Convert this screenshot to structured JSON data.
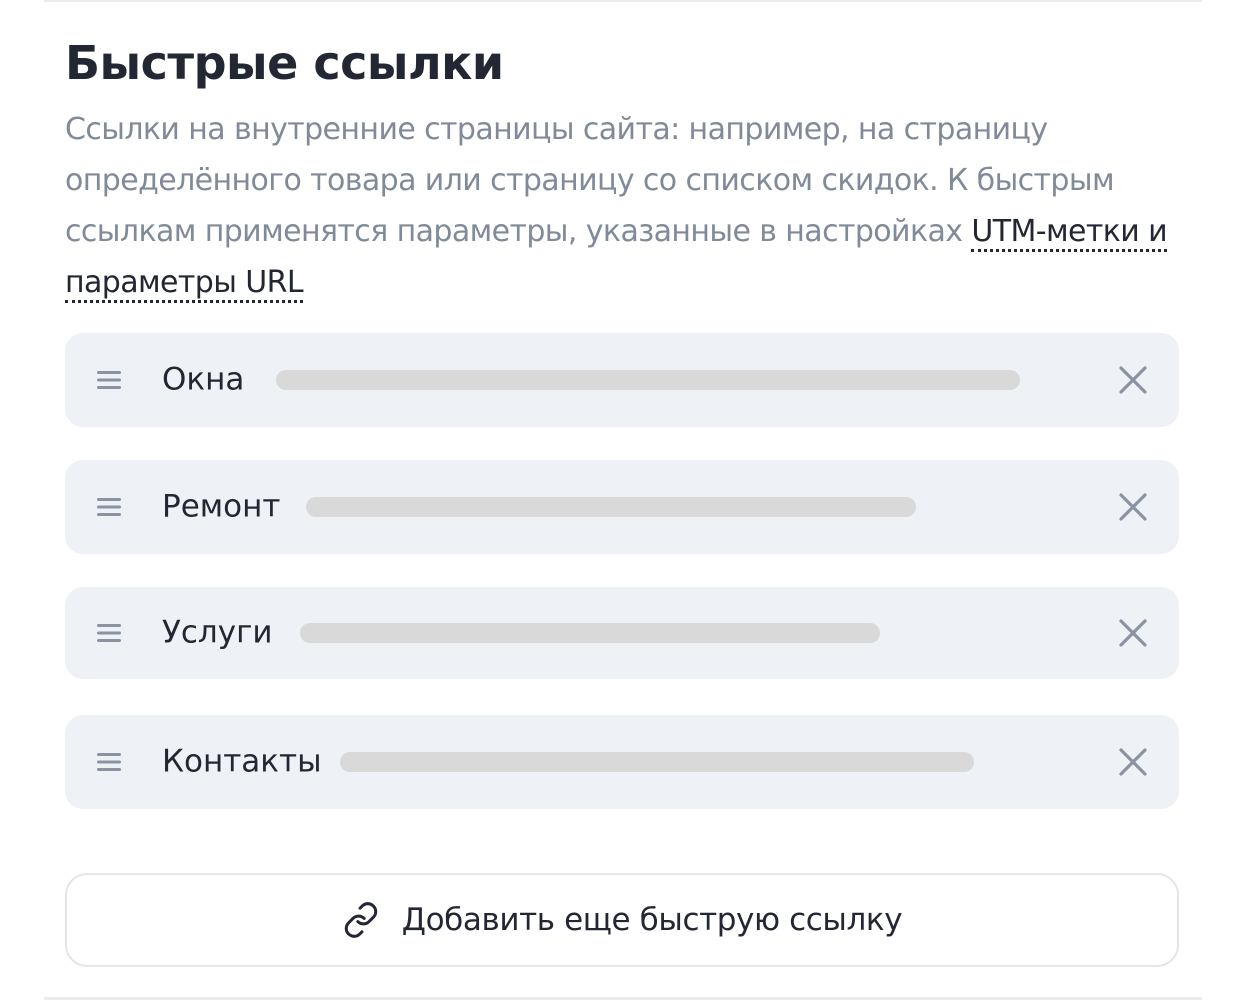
{
  "section": {
    "title": "Быстрые ссылки",
    "description_text": "Ссылки на внутренние страницы сайта: например, на страницу определённого товара или страницу со списком скидок. К быстрым ссылкам применятся параметры, указанные в настройках ",
    "utm_link_label": "UTM-метки и параметры URL"
  },
  "quick_links": [
    {
      "label": "Окна",
      "url_fill": 0.74
    },
    {
      "label": "Ремонт",
      "url_fill": 0.61
    },
    {
      "label": "Услуги",
      "url_fill": 0.58
    },
    {
      "label": "Контакты",
      "url_fill": 0.63
    }
  ],
  "add_button": {
    "label": "Добавить еще быструю ссылку",
    "icon": "link-icon"
  },
  "icons": {
    "drag": "drag-handle-icon",
    "remove": "close-icon"
  },
  "colors": {
    "row_background": "#eef1f6",
    "placeholder_bar": "#d9d9d9",
    "description_text": "#808a99",
    "icon": "#8b93a3"
  }
}
